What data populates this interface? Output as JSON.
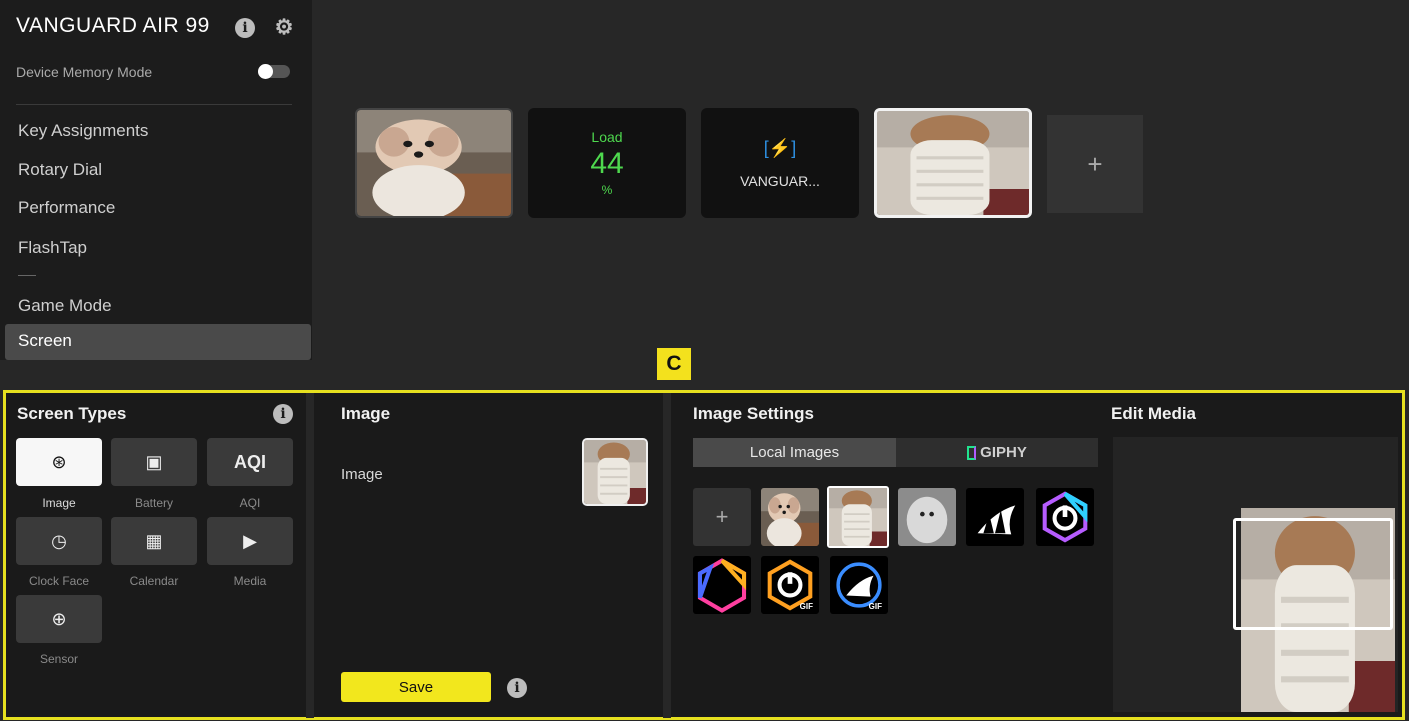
{
  "sidebar": {
    "device_name": "VANGUARD AIR 99",
    "device_memory_mode_label": "Device Memory Mode",
    "device_memory_mode_on": false,
    "nav_items": [
      {
        "label": "Key Assignments"
      },
      {
        "label": "Rotary Dial"
      },
      {
        "label": "Performance"
      },
      {
        "label": "FlashTap"
      },
      {
        "label": "Game Mode"
      },
      {
        "label": "Screen",
        "selected": true
      }
    ]
  },
  "screens": {
    "tiles": [
      {
        "type": "image",
        "icon": "dog-photo"
      },
      {
        "type": "sensor",
        "label": "Load",
        "value": "44",
        "unit": "%",
        "color": "#4ed84e"
      },
      {
        "type": "battery",
        "icon": "battery-charging-icon",
        "label": "VANGUAR...",
        "color": "#2e8fe0"
      },
      {
        "type": "image",
        "icon": "dog-sweater-photo",
        "selected": true
      }
    ],
    "add_label": "+"
  },
  "callout_label": "C",
  "screen_types": {
    "title": "Screen Types",
    "items": [
      {
        "label": "Image",
        "icon": "image-icon",
        "glyph": "⊛",
        "selected": true
      },
      {
        "label": "Battery",
        "icon": "battery-icon",
        "glyph": "▣"
      },
      {
        "label": "AQI",
        "icon": "aqi-icon",
        "glyph": "AQI"
      },
      {
        "label": "Clock Face",
        "icon": "clock-icon",
        "glyph": "◷"
      },
      {
        "label": "Calendar",
        "icon": "calendar-icon",
        "glyph": "▦"
      },
      {
        "label": "Media",
        "icon": "media-icon",
        "glyph": "▶"
      },
      {
        "label": "Sensor",
        "icon": "sensor-icon",
        "glyph": "⊕"
      }
    ]
  },
  "image_panel": {
    "title": "Image",
    "field_label": "Image",
    "save_label": "Save"
  },
  "image_settings": {
    "title": "Image Settings",
    "tabs": [
      {
        "label": "Local Images",
        "selected": true
      },
      {
        "label": "GIPHY"
      }
    ],
    "add_label": "+",
    "library": [
      {
        "icon": "dog-photo"
      },
      {
        "icon": "dog-sweater-photo",
        "selected": true
      },
      {
        "icon": "blurry-dog-photo"
      },
      {
        "icon": "corsair-sails-logo"
      },
      {
        "icon": "icue-rgb-logo"
      },
      {
        "icon": "rgb-hexagon"
      },
      {
        "icon": "icue-gif",
        "badge": "GIF"
      },
      {
        "icon": "corsair-gif",
        "badge": "GIF"
      }
    ]
  },
  "edit_media": {
    "title": "Edit Media"
  },
  "colors": {
    "accent": "#f2e71d",
    "background": "#272727",
    "panel": "#1a1a1a"
  }
}
